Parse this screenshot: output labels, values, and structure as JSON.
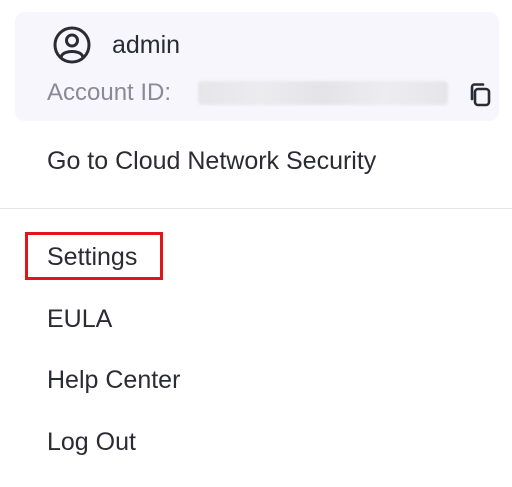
{
  "account": {
    "username": "admin",
    "account_id_label": "Account ID:",
    "user_icon": "user-circle-icon",
    "copy_icon": "copy-icon"
  },
  "menu": {
    "cloud_network_security": "Go to Cloud Network Security",
    "settings": "Settings",
    "eula": "EULA",
    "help_center": "Help Center",
    "log_out": "Log Out"
  },
  "colors": {
    "card_background": "#f6f6fc",
    "highlight_border": "#e0161b",
    "text_primary": "#2b2b34",
    "text_secondary": "#8a8a94"
  }
}
